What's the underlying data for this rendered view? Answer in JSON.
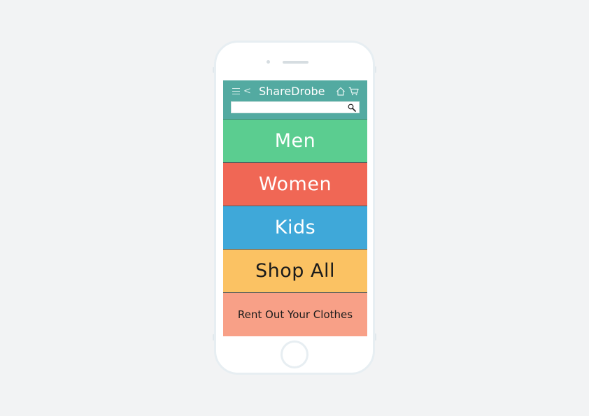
{
  "app": {
    "brand": "ShareDrobe"
  },
  "header": {
    "menu_icon": "hamburger-menu-icon",
    "back_icon": "<",
    "home_icon": "home-icon",
    "cart_icon": "cart-icon",
    "search_icon": "search-icon",
    "search_value": "",
    "colors": {
      "bar": "#53aaa1",
      "text": "#ffffff"
    }
  },
  "categories": [
    {
      "label": "Men",
      "color": "#5bcd90",
      "text_color": "#ffffff"
    },
    {
      "label": "Women",
      "color": "#f06755",
      "text_color": "#ffffff"
    },
    {
      "label": "Kids",
      "color": "#3fa8d9",
      "text_color": "#ffffff"
    },
    {
      "label": "Shop All",
      "color": "#fbc263",
      "text_color": "#1b1b1b"
    },
    {
      "label": "Rent Out Your Clothes",
      "color": "#f8a087",
      "text_color": "#1b1b1b"
    }
  ]
}
